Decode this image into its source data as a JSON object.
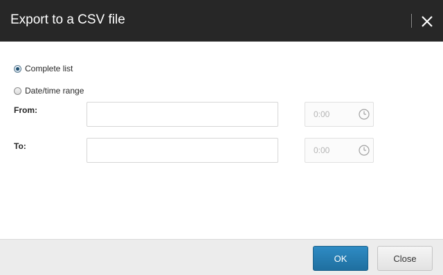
{
  "dialog": {
    "title": "Export to a CSV file",
    "close_icon": "close-icon"
  },
  "options": {
    "complete_list_label": "Complete list",
    "complete_list_selected": true,
    "date_range_label": "Date/time range",
    "date_range_selected": false
  },
  "range": {
    "from_label": "From:",
    "from_date_value": "",
    "from_time_value": "0:00",
    "to_label": "To:",
    "to_date_value": "",
    "to_time_value": "0:00",
    "time_icon": "clock-icon"
  },
  "footer": {
    "ok_label": "OK",
    "close_label": "Close"
  },
  "colors": {
    "header_bg": "#272727",
    "ok_button": "#2a82b8",
    "footer_bg": "#ececec"
  }
}
